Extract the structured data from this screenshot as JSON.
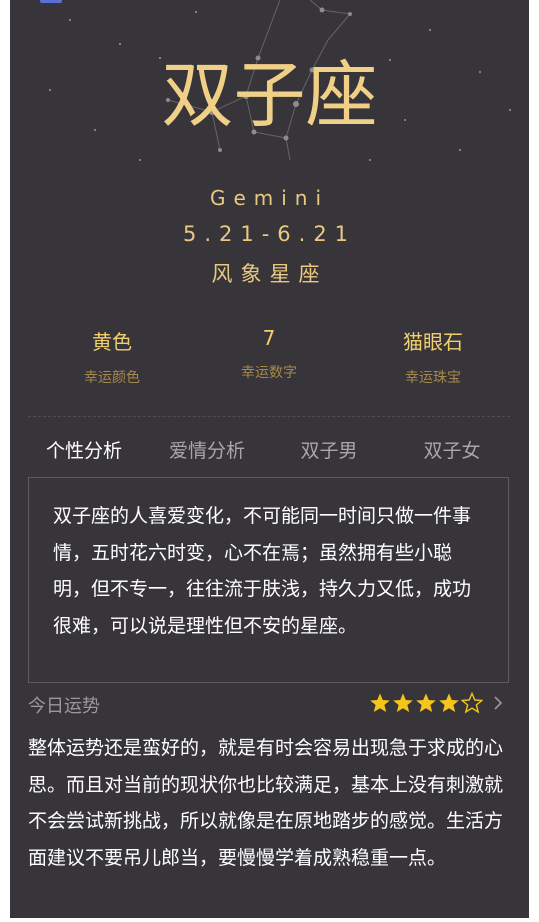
{
  "header": {
    "title": "双子座",
    "english_name": "Gemini",
    "date_range": "5.21-6.21",
    "element": "风象星座"
  },
  "lucky": [
    {
      "value": "黄色",
      "label": "幸运颜色"
    },
    {
      "value": "7",
      "label": "幸运数字"
    },
    {
      "value": "猫眼石",
      "label": "幸运珠宝"
    }
  ],
  "tabs": [
    {
      "label": "个性分析",
      "active": true
    },
    {
      "label": "爱情分析",
      "active": false
    },
    {
      "label": "双子男",
      "active": false
    },
    {
      "label": "双子女",
      "active": false
    }
  ],
  "analysis": {
    "text": "双子座的人喜爱变化，不可能同一时间只做一件事情，五时花六时变，心不在焉；虽然拥有些小聪明，但不专一，往往流于肤浅，持久力又低，成功很难，可以说是理性但不安的星座。"
  },
  "fortune": {
    "label": "今日运势",
    "rating": 4,
    "rating_max": 5,
    "text": "整体运势还是蛮好的，就是有时会容易出现急于求成的心思。而且对当前的现状你也比较满足，基本上没有刺激就不会尝试新挑战，所以就像是在原地踏步的感觉。生活方面建议不要吊儿郎当，要慢慢学着成熟稳重一点。"
  },
  "colors": {
    "background": "#373539",
    "gold": "#f0cf86",
    "star_fill": "#f5c51c"
  }
}
